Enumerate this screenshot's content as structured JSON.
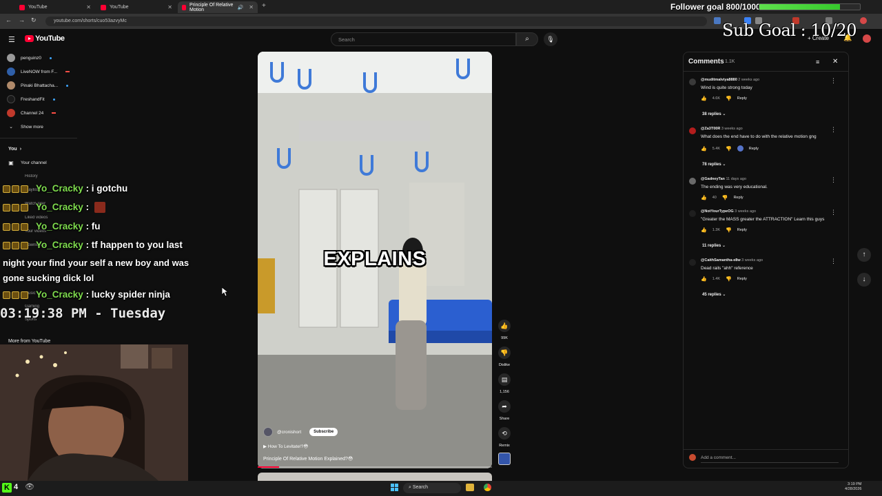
{
  "browser": {
    "tabs": [
      {
        "label": "YouTube",
        "active": false
      },
      {
        "label": "YouTube",
        "active": false
      },
      {
        "label": "Principle Of Relative Motion",
        "active": true
      }
    ],
    "url": "youtube.com/shorts/cuo53azvyMc"
  },
  "youtube": {
    "logo_text": "YouTube",
    "search_placeholder": "Search",
    "create_label": "Create"
  },
  "sidebar": {
    "subscriptions": [
      {
        "label": "penguinz0",
        "indicator": "dot"
      },
      {
        "label": "LiveNOW from F...",
        "indicator": "live"
      },
      {
        "label": "Pinaki Bhattacha...",
        "indicator": "dot"
      },
      {
        "label": "FreshandFit",
        "indicator": "dot"
      },
      {
        "label": "Channel 24",
        "indicator": "live"
      }
    ],
    "show_more": "Show more",
    "you_label": "You",
    "your_channel": "Your channel",
    "ghost_items": [
      "History",
      "Playlists",
      "Watch later",
      "Liked videos",
      "Your videos",
      "Downloads",
      "Explore",
      "Music",
      "Gaming",
      "Sports"
    ],
    "more_from": "More from YouTube"
  },
  "chat": {
    "lines": [
      {
        "user": "Yo_Cracky",
        "message": ": i gotchu"
      },
      {
        "user": "Yo_Cracky",
        "message": ":"
      },
      {
        "user": "Yo_Cracky",
        "message": ": fu"
      },
      {
        "user": "Yo_Cracky",
        "message": ": tf happen to you last"
      },
      {
        "user": "Yo_Cracky",
        "message": ": lucky spider ninja"
      }
    ],
    "continuation": "night your find your self a new boy and was gone sucking dick lol",
    "clock": "03:19:38 PM - Tuesday"
  },
  "video": {
    "caption": "EXPLAINS",
    "channel": "@cronishort",
    "subscribe_label": "Subscribe",
    "link_text": "How To Levitate!?😳",
    "title": "Principle Of Relative Motion Explained?😳",
    "progress": 0.09
  },
  "actions": {
    "like_count": "99K",
    "dislike_label": "Dislike",
    "comment_count": "1,156",
    "share_label": "Share",
    "remix_label": "Remix"
  },
  "comments": {
    "title": "Comments",
    "count": "1.1K",
    "items": [
      {
        "author": "@muditmalviya8880",
        "time": "2 weeks ago",
        "text": "Wind is quite strong today",
        "likes": "4.6K",
        "replies": "38 replies",
        "avatar_color": "#3a3a3a"
      },
      {
        "author": "@Za3T00R",
        "time": "3 weeks ago",
        "text": "What does the end have to do with the relative motion gng",
        "likes": "5.4K",
        "replies": "78 replies",
        "avatar_color": "#b31d1d"
      },
      {
        "author": "@GadneyTan",
        "time": "11 days ago",
        "text": "The ending was very educational.",
        "likes": "40",
        "replies": "",
        "avatar_color": "#6a6a6a"
      },
      {
        "author": "@NotYourTypeOG",
        "time": "3 weeks ago",
        "text": "\"Greater the MASS greater the ATTRACTION\" Learn this guys",
        "likes": "1.3K",
        "replies": "11 replies",
        "avatar_color": "#1f1f1f"
      },
      {
        "author": "@CaithSamantha-e8w",
        "time": "3 weeks ago",
        "text": "Dead rails \"ahh\" reference",
        "likes": "1.4K",
        "replies": "45 replies",
        "avatar_color": "#1f1f1f"
      }
    ],
    "reply_label": "Reply",
    "add_placeholder": "Add a comment..."
  },
  "overlays": {
    "follower_goal": "Follower goal 800/1000",
    "follower_progress": 0.8,
    "sub_goal": "Sub Goal : 10/20"
  },
  "taskbar": {
    "kick_count": "4",
    "search_label": "Search",
    "time": "3:19 PM",
    "date": "4/28/2026"
  },
  "colors": {
    "youtube_red": "#ff0033",
    "chat_username": "#7fdc4e",
    "goal_green": "#5ee04c"
  }
}
